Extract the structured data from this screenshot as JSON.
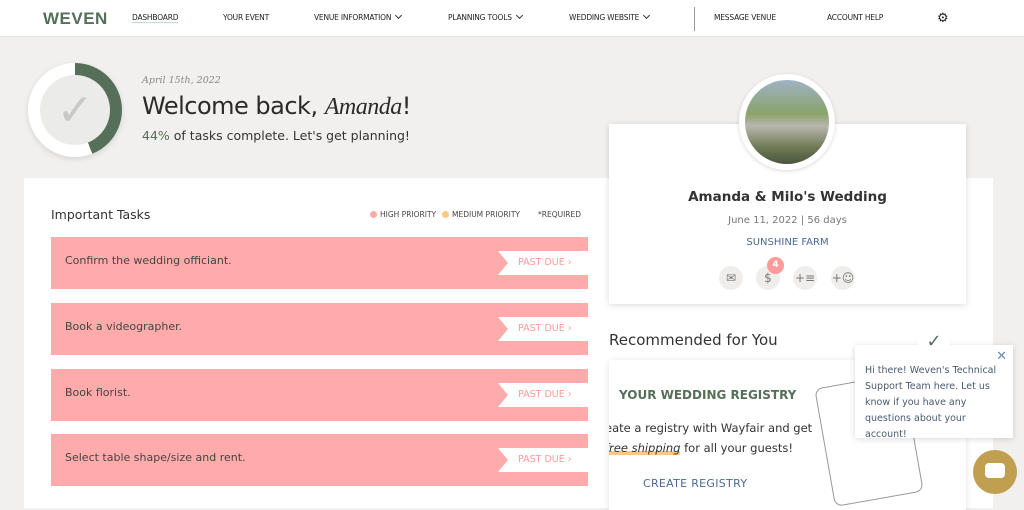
{
  "header": {
    "logo": "WEVEN",
    "nav": [
      {
        "label": "DASHBOARD"
      },
      {
        "label": "YOUR EVENT"
      },
      {
        "label": "VENUE INFORMATION"
      },
      {
        "label": "PLANNING TOOLS"
      },
      {
        "label": "WEDDING WEBSITE"
      },
      {
        "label": "MESSAGE VENUE"
      },
      {
        "label": "ACCOUNT HELP"
      }
    ],
    "settings_icon": "gear-icon"
  },
  "welcome": {
    "date": "April 15th, 2022",
    "greeting": "Welcome back, ",
    "name": "Amanda",
    "exclaim": "!",
    "percent": "44%",
    "progress_text": " of tasks complete. Let's get planning!",
    "progress_value": 44,
    "accent": "#566f58"
  },
  "tasks": {
    "title": "Important Tasks",
    "legend_high": "HIGH PRIORITY",
    "legend_medium": "MEDIUM PRIORITY",
    "legend_required": "*REQUIRED",
    "high_color": "#ffabab",
    "medium_color": "#ffc784",
    "items": [
      {
        "label": "Confirm the wedding officiant.",
        "status": "PAST DUE"
      },
      {
        "label": "Book a videographer.",
        "status": "PAST DUE"
      },
      {
        "label": "Book florist.",
        "status": "PAST DUE"
      },
      {
        "label": "Select table shape/size and rent.",
        "status": "PAST DUE"
      }
    ]
  },
  "event": {
    "name": "Amanda & Milo's Wedding",
    "date_line": "June 11, 2022 | 56 days",
    "venue": "SUNSHINE FARM",
    "payments_badge": "4"
  },
  "recommended": {
    "title": "Recommended for You",
    "registry_title": "YOUR WEDDING REGISTRY",
    "text1": "eate a registry with Wayfair and get",
    "text2_em": "free shipping",
    "text2": " for all your guests!",
    "button": "CREATE REGISTRY"
  },
  "chat": {
    "message": "Hi there! Weven's Technical Support Team here. Let us know if you have any questions about your account!",
    "close": "✕"
  }
}
